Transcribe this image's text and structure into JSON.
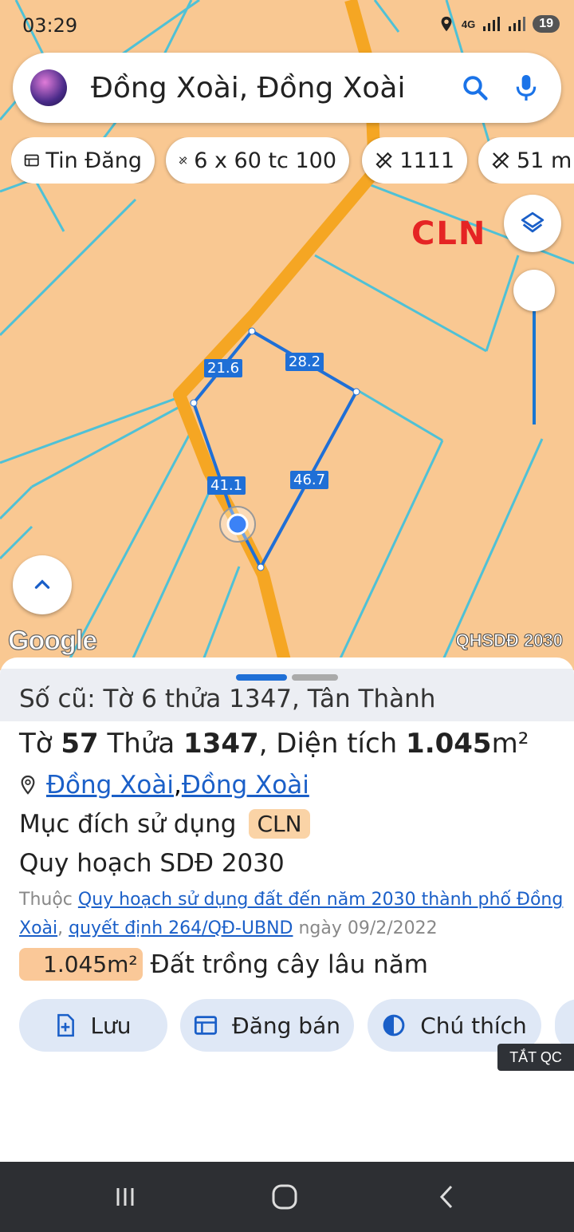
{
  "status_bar": {
    "time": "03:29",
    "network_label": "4G",
    "battery": "19"
  },
  "search": {
    "query": "Đồng Xoài, Đồng Xoài"
  },
  "chips": [
    {
      "label": "Tin Đăng",
      "icon": "listing-icon"
    },
    {
      "label": "6 x 60 tc 100",
      "icon": "measure-icon"
    },
    {
      "label": "1111",
      "icon": "measure-icon"
    },
    {
      "label": "51 m",
      "icon": "measure-icon"
    }
  ],
  "map": {
    "land_use_label": "CLN",
    "edge_lengths": [
      "21.6",
      "28.2",
      "41.1",
      "46.7"
    ],
    "attribution": "Google",
    "layer_label": "QHSDĐ 2030",
    "colors": {
      "land": "#f9c892",
      "road": "#f5a623",
      "parcel_lines": "#4fc1d6",
      "selection": "#1f6fd6",
      "label_red": "#e52424"
    }
  },
  "sheet": {
    "old_record": "Số cũ: Tờ 6 thửa 1347, Tân Thành",
    "parcel": {
      "sheet_prefix": "Tờ ",
      "sheet_no": "57",
      "plot_prefix": " Thửa ",
      "plot_no": "1347",
      "area_prefix": ", Diện tích ",
      "area": "1.045",
      "area_unit": "m²"
    },
    "location": {
      "ward": "Đồng Xoài",
      "separator": ", ",
      "city": "Đồng Xoài"
    },
    "purpose_label": "Mục đích sử dụng",
    "purpose_code": "CLN",
    "plan_title": "Quy hoạch SDĐ 2030",
    "plan_desc": {
      "prefix": "Thuộc ",
      "plan_link": "Quy hoạch sử dụng đất đến năm 2030 thành phố Đồng Xoài",
      "sep": ", ",
      "decision_link": "quyết định 264/QĐ-UBND",
      "date_text": " ngày 09/2/2022"
    },
    "area_chip": "1.045m²",
    "area_desc": "Đất trồng cây lâu năm",
    "actions": [
      "Lưu",
      "Đăng bán",
      "Chú thích"
    ],
    "ads_label": "TẮT QC"
  }
}
